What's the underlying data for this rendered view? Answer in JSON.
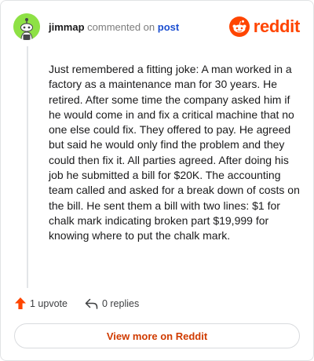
{
  "comment": {
    "username": "jimmap",
    "verb": "commented on",
    "target_link": "post",
    "avatar_color": "#8ee145",
    "body": "Just remembered a fitting joke: A man worked in a factory as a maintenance man for 30 years. He retired. After some time the company asked him if he would come in and fix a critical machine that no one else could fix. They offered to pay. He agreed but said he would only find the problem and they could then fix it. All parties agreed. After doing his job he submitted a bill for $20K. The accounting team called and asked for a break down of costs on the bill. He sent them a bill with two lines: $1 for chalk mark indicating broken part $19,999 for knowing where to put the chalk mark."
  },
  "brand": {
    "name": "reddit",
    "color": "#ff4500",
    "icon": "reddit-alien-icon"
  },
  "actions": {
    "upvote_label": "1 upvote",
    "upvote_icon": "upvote-arrow-icon",
    "replies_label": "0 replies",
    "replies_icon": "reply-arrow-icon"
  },
  "footer": {
    "button_label": "View more on Reddit"
  }
}
